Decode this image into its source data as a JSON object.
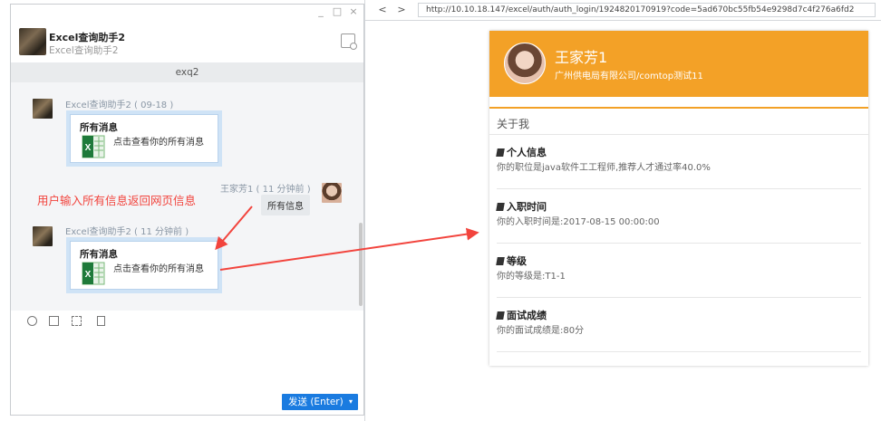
{
  "chat_window": {
    "controls": {
      "minimize": "_",
      "maximize": "□",
      "close": "×"
    },
    "contact_name": "Excel查询助手2",
    "contact_sub": "Excel查询助手2",
    "group_name": "exq2"
  },
  "messages": [
    {
      "sender_line": "Excel查询助手2 ( 09-18 )",
      "card_title": "所有消息",
      "card_text": "点击查看你的所有消息"
    },
    {
      "sender_line": "王家芳1 ( 11 分钟前 )",
      "bubble_text": "所有信息"
    },
    {
      "sender_line": "Excel查询助手2 ( 11 分钟前 )",
      "card_title": "所有消息",
      "card_text": "点击查看你的所有消息"
    }
  ],
  "annotation": "用户输入所有信息返回网页信息",
  "send_button": "发送 (Enter)",
  "send_caret": "▾",
  "browser": {
    "back": "<",
    "forward": ">",
    "url": "http://10.10.18.147/excel/auth/auth_login/1924820170919?code=5ad670bc55fb54e9298d7c4f276a6fd2"
  },
  "profile": {
    "name": "王家芳1",
    "org": "广州供电局有限公司/comtop测试11",
    "about_label": "关于我",
    "sections": [
      {
        "title": "个人信息",
        "body": "你的职位是java软件工工程师,推荐人才通过率40.0%"
      },
      {
        "title": "入职时间",
        "body": "你的入职时间是:2017-08-15 00:00:00"
      },
      {
        "title": "等级",
        "body": "你的等级是:T1-1"
      },
      {
        "title": "面试成绩",
        "body": "你的面试成绩是:80分"
      }
    ]
  },
  "colors": {
    "accent_orange": "#f3a127",
    "annotation_red": "#f2443d",
    "send_blue": "#1a7be0"
  }
}
